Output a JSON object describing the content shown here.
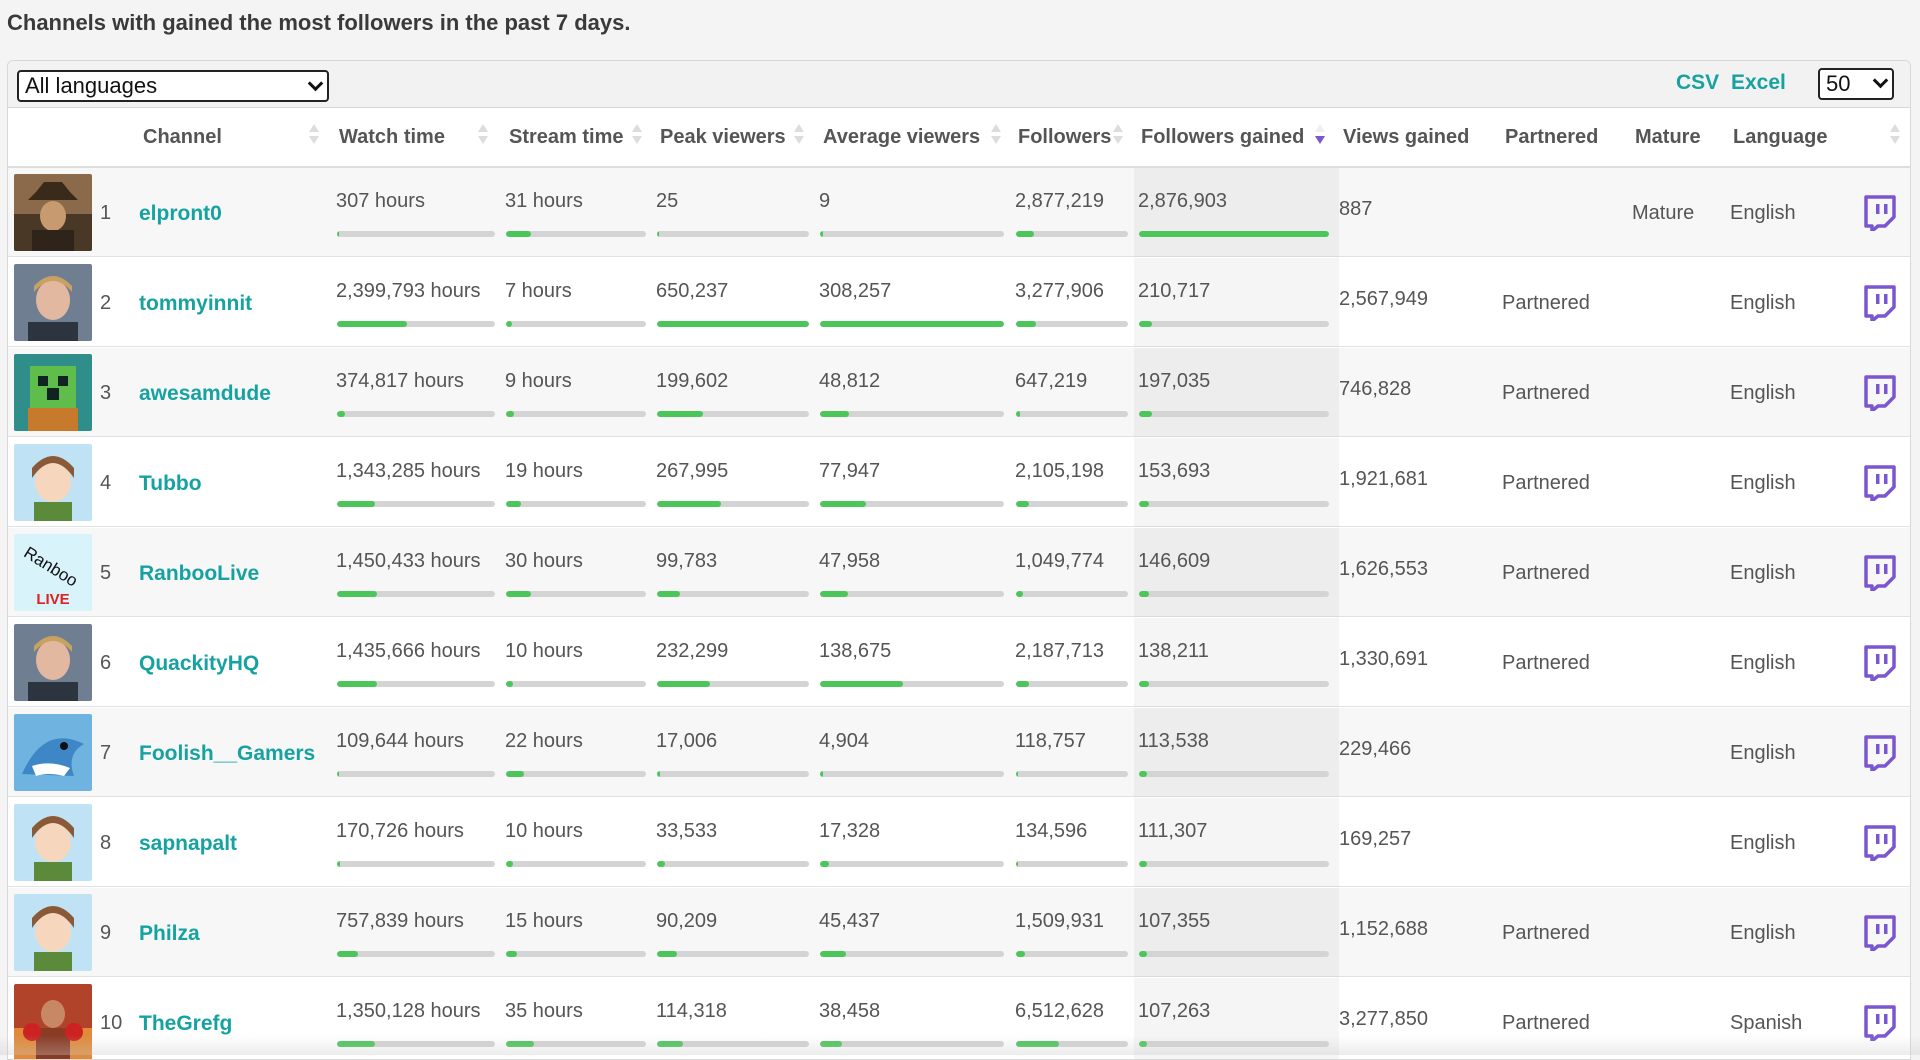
{
  "page_title": "Channels with gained the most followers in the past 7 days.",
  "toolbar": {
    "language_select": "All languages",
    "csv_label": "CSV",
    "excel_label": "Excel",
    "page_size": "50"
  },
  "columns": {
    "channel": "Channel",
    "watch_time": "Watch time",
    "stream_time": "Stream time",
    "peak_viewers": "Peak viewers",
    "average_viewers": "Average viewers",
    "followers": "Followers",
    "followers_gained": "Followers gained",
    "views_gained": "Views gained",
    "partnered": "Partnered",
    "mature": "Mature",
    "language": "Language"
  },
  "sorted_column": "followers_gained",
  "colors": {
    "accent": "#17a2a2",
    "bar": "#4cc65a",
    "twitch": "#7a57d1"
  },
  "rows": [
    {
      "rank": "1",
      "channel": "elpront0",
      "watch_time": "307 hours",
      "stream_time": "31 hours",
      "peak_viewers": "25",
      "average_viewers": "9",
      "followers": "2,877,219",
      "followers_gained": "2,876,903",
      "views_gained": "887",
      "partnered": "",
      "mature": "Mature",
      "language": "English",
      "fills": {
        "watch_time": 0.0,
        "stream_time": 0.18,
        "peak_viewers": 0.0,
        "average_viewers": 0.0,
        "followers": 0.16,
        "followers_gained": 1.0
      },
      "avatar_icon": "cowboy-avatar"
    },
    {
      "rank": "2",
      "channel": "tommyinnit",
      "watch_time": "2,399,793 hours",
      "stream_time": "7 hours",
      "peak_viewers": "650,237",
      "average_viewers": "308,257",
      "followers": "3,277,906",
      "followers_gained": "210,717",
      "views_gained": "2,567,949",
      "partnered": "Partnered",
      "mature": "",
      "language": "English",
      "fills": {
        "watch_time": 0.44,
        "stream_time": 0.04,
        "peak_viewers": 1.0,
        "average_viewers": 1.0,
        "followers": 0.18,
        "followers_gained": 0.07
      },
      "avatar_icon": "person-avatar"
    },
    {
      "rank": "3",
      "channel": "awesamdude",
      "watch_time": "374,817 hours",
      "stream_time": "9 hours",
      "peak_viewers": "199,602",
      "average_viewers": "48,812",
      "followers": "647,219",
      "followers_gained": "197,035",
      "views_gained": "746,828",
      "partnered": "Partnered",
      "mature": "",
      "language": "English",
      "fills": {
        "watch_time": 0.05,
        "stream_time": 0.06,
        "peak_viewers": 0.3,
        "average_viewers": 0.16,
        "followers": 0.04,
        "followers_gained": 0.07
      },
      "avatar_icon": "creeper-avatar"
    },
    {
      "rank": "4",
      "channel": "Tubbo",
      "watch_time": "1,343,285 hours",
      "stream_time": "19 hours",
      "peak_viewers": "267,995",
      "average_viewers": "77,947",
      "followers": "2,105,198",
      "followers_gained": "153,693",
      "views_gained": "1,921,681",
      "partnered": "Partnered",
      "mature": "",
      "language": "English",
      "fills": {
        "watch_time": 0.24,
        "stream_time": 0.11,
        "peak_viewers": 0.42,
        "average_viewers": 0.25,
        "followers": 0.12,
        "followers_gained": 0.05
      },
      "avatar_icon": "anime-avatar"
    },
    {
      "rank": "5",
      "channel": "RanbooLive",
      "watch_time": "1,450,433 hours",
      "stream_time": "30 hours",
      "peak_viewers": "99,783",
      "average_viewers": "47,958",
      "followers": "1,049,774",
      "followers_gained": "146,609",
      "views_gained": "1,626,553",
      "partnered": "Partnered",
      "mature": "",
      "language": "English",
      "fills": {
        "watch_time": 0.25,
        "stream_time": 0.18,
        "peak_viewers": 0.15,
        "average_viewers": 0.15,
        "followers": 0.06,
        "followers_gained": 0.05
      },
      "avatar_icon": "ranboo-logo-avatar",
      "avatar_text": [
        "Ranboo",
        "LIVE"
      ]
    },
    {
      "rank": "6",
      "channel": "QuackityHQ",
      "watch_time": "1,435,666 hours",
      "stream_time": "10 hours",
      "peak_viewers": "232,299",
      "average_viewers": "138,675",
      "followers": "2,187,713",
      "followers_gained": "138,211",
      "views_gained": "1,330,691",
      "partnered": "Partnered",
      "mature": "",
      "language": "English",
      "fills": {
        "watch_time": 0.25,
        "stream_time": 0.05,
        "peak_viewers": 0.35,
        "average_viewers": 0.45,
        "followers": 0.12,
        "followers_gained": 0.05
      },
      "avatar_icon": "person-avatar"
    },
    {
      "rank": "7",
      "channel": "Foolish__Gamers",
      "watch_time": "109,644 hours",
      "stream_time": "22 hours",
      "peak_viewers": "17,006",
      "average_viewers": "4,904",
      "followers": "118,757",
      "followers_gained": "113,538",
      "views_gained": "229,466",
      "partnered": "",
      "mature": "",
      "language": "English",
      "fills": {
        "watch_time": 0.01,
        "stream_time": 0.13,
        "peak_viewers": 0.02,
        "average_viewers": 0.01,
        "followers": 0.01,
        "followers_gained": 0.04
      },
      "avatar_icon": "shark-avatar"
    },
    {
      "rank": "8",
      "channel": "sapnapalt",
      "watch_time": "170,726 hours",
      "stream_time": "10 hours",
      "peak_viewers": "33,533",
      "average_viewers": "17,328",
      "followers": "134,596",
      "followers_gained": "111,307",
      "views_gained": "169,257",
      "partnered": "",
      "mature": "",
      "language": "English",
      "fills": {
        "watch_time": 0.02,
        "stream_time": 0.05,
        "peak_viewers": 0.05,
        "average_viewers": 0.05,
        "followers": 0.01,
        "followers_gained": 0.04
      },
      "avatar_icon": "anime-avatar"
    },
    {
      "rank": "9",
      "channel": "Philza",
      "watch_time": "757,839 hours",
      "stream_time": "15 hours",
      "peak_viewers": "90,209",
      "average_viewers": "45,437",
      "followers": "1,509,931",
      "followers_gained": "107,355",
      "views_gained": "1,152,688",
      "partnered": "Partnered",
      "mature": "",
      "language": "English",
      "fills": {
        "watch_time": 0.13,
        "stream_time": 0.08,
        "peak_viewers": 0.13,
        "average_viewers": 0.14,
        "followers": 0.08,
        "followers_gained": 0.04
      },
      "avatar_icon": "anime-avatar"
    },
    {
      "rank": "10",
      "channel": "TheGrefg",
      "watch_time": "1,350,128 hours",
      "stream_time": "35 hours",
      "peak_viewers": "114,318",
      "average_viewers": "38,458",
      "followers": "6,512,628",
      "followers_gained": "107,263",
      "views_gained": "3,277,850",
      "partnered": "Partnered",
      "mature": "",
      "language": "Spanish",
      "fills": {
        "watch_time": 0.24,
        "stream_time": 0.2,
        "peak_viewers": 0.17,
        "average_viewers": 0.12,
        "followers": 0.38,
        "followers_gained": 0.04
      },
      "avatar_icon": "boxer-avatar"
    }
  ]
}
